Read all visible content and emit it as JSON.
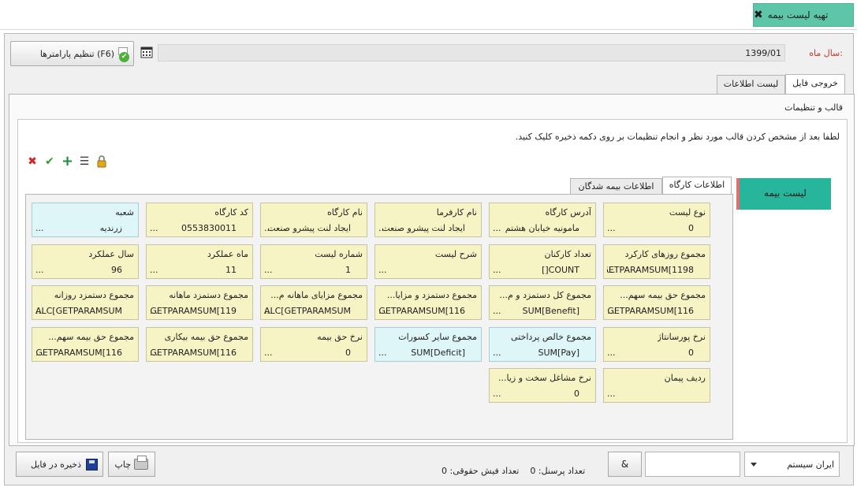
{
  "header": {
    "title": "تهیه لیست بیمه",
    "close_icon": "close-icon"
  },
  "form": {
    "year_month_label": "سال ماه:",
    "year_month_value": "1399/01",
    "params_button": "تنظیم پارامترها (F6)"
  },
  "tabs": [
    {
      "label": "خروجی فایل",
      "active": true
    },
    {
      "label": "لیست اطلاعات",
      "active": false
    }
  ],
  "template_section": {
    "title": "قالب و تنظیمات",
    "instruction": "لطفا بعد از مشخص کردن قالب مورد نظر و انجام تنظیمات بر روی دکمه ذخیره کلیک کنید.",
    "toolbar_icons": [
      "lock-icon",
      "list-icon",
      "add-icon",
      "confirm-icon",
      "delete-icon"
    ]
  },
  "side_list": {
    "item_label": "لیست بیمه"
  },
  "subtabs": [
    {
      "label": "اطلاعات کارگاه",
      "active": true
    },
    {
      "label": "اطلاعات بیمه شدگان",
      "active": false
    }
  ],
  "fields": [
    {
      "label": "نوع لیست",
      "value": "0",
      "dots": "...",
      "style": "yellow"
    },
    {
      "label": "آدرس کارگاه",
      "value": "مامونیه خیابان هشتم",
      "dots": "...",
      "style": "yellow"
    },
    {
      "label": "نام کارفرما",
      "value": "ایجاد لنت پیشرو صنعت",
      "dots": "...",
      "style": "yellow"
    },
    {
      "label": "نام کارگاه",
      "value": "ایجاد لنت پیشرو صنعت",
      "dots": "...",
      "style": "yellow"
    },
    {
      "label": "کد کارگاه",
      "value": "0553830011",
      "dots": "...",
      "style": "yellow"
    },
    {
      "label": "شعبه",
      "value": "زرندیه",
      "dots": "...",
      "style": "blue"
    },
    {
      "label": "مجموع روزهای کارکرد",
      "value": "GETPARAMSUM[1198",
      "dots": "...",
      "style": "yellow"
    },
    {
      "label": "تعداد کارکنان",
      "value": "COUNT[]",
      "dots": "...",
      "style": "yellow"
    },
    {
      "label": "شرح لیست",
      "value": "",
      "dots": "...",
      "style": "yellow"
    },
    {
      "label": "شماره لیست",
      "value": "1",
      "dots": "...",
      "style": "yellow"
    },
    {
      "label": "ماه عملکرد",
      "value": "11",
      "dots": "...",
      "style": "yellow"
    },
    {
      "label": "سال عملکرد",
      "value": "96",
      "dots": "...",
      "style": "yellow"
    },
    {
      "label": "مجموع حق بیمه سهم...",
      "value": "GETPARAMSUM[116",
      "dots": "...",
      "style": "yellow"
    },
    {
      "label": "مجموع کل دستمزد و م...",
      "value": "SUM[Benefit]",
      "dots": "...",
      "style": "yellow"
    },
    {
      "label": "مجموع دستمزد و مزایا...",
      "value": "GETPARAMSUM[116",
      "dots": "...",
      "style": "yellow"
    },
    {
      "label": "مجموع مزایای ماهانه م...",
      "value": "CALC[GETPARAMSUM",
      "dots": "...",
      "style": "yellow"
    },
    {
      "label": "مجموع دستمزد ماهانه",
      "value": "GETPARAMSUM[119",
      "dots": "...",
      "style": "yellow"
    },
    {
      "label": "مجموع دستمزد روزانه",
      "value": "CALC[GETPARAMSUM",
      "dots": "...",
      "style": "yellow"
    },
    {
      "label": "نرخ پورسانتاژ",
      "value": "0",
      "dots": "...",
      "style": "yellow"
    },
    {
      "label": "مجموع خالص پرداختی",
      "value": "SUM[Pay]",
      "dots": "...",
      "style": "blue"
    },
    {
      "label": "مجموع سایر کسورات",
      "value": "SUM[Deficit]",
      "dots": "...",
      "style": "blue"
    },
    {
      "label": "نرخ حق بیمه",
      "value": "0",
      "dots": "...",
      "style": "yellow"
    },
    {
      "label": "مجموع حق بیمه بیکاری",
      "value": "GETPARAMSUM[116",
      "dots": "...",
      "style": "yellow"
    },
    {
      "label": "مجموع حق بیمه سهم...",
      "value": "GETPARAMSUM[116",
      "dots": "...",
      "style": "yellow"
    },
    {
      "label": "ردیف پیمان",
      "value": "",
      "dots": "...",
      "style": "yellow"
    },
    {
      "label": "نرخ مشاغل سخت و زیا...",
      "value": "0",
      "dots": "...",
      "style": "yellow"
    }
  ],
  "footer": {
    "system_select": "ایران سیستم",
    "amp_button": "&",
    "personnel_count_label": "تعداد پرسنل:",
    "personnel_count": "0",
    "payslip_count_label": "تعداد فیش حقوقی:",
    "payslip_count": "0",
    "print_button": "چاپ",
    "save_button": "ذخیره در فایل"
  },
  "colors": {
    "title_tab": "#5dc6a8",
    "side_item": "#27b59c",
    "card_yellow": "#f6f4c4",
    "card_blue": "#dff6f8",
    "year_label": "#c0392b"
  }
}
